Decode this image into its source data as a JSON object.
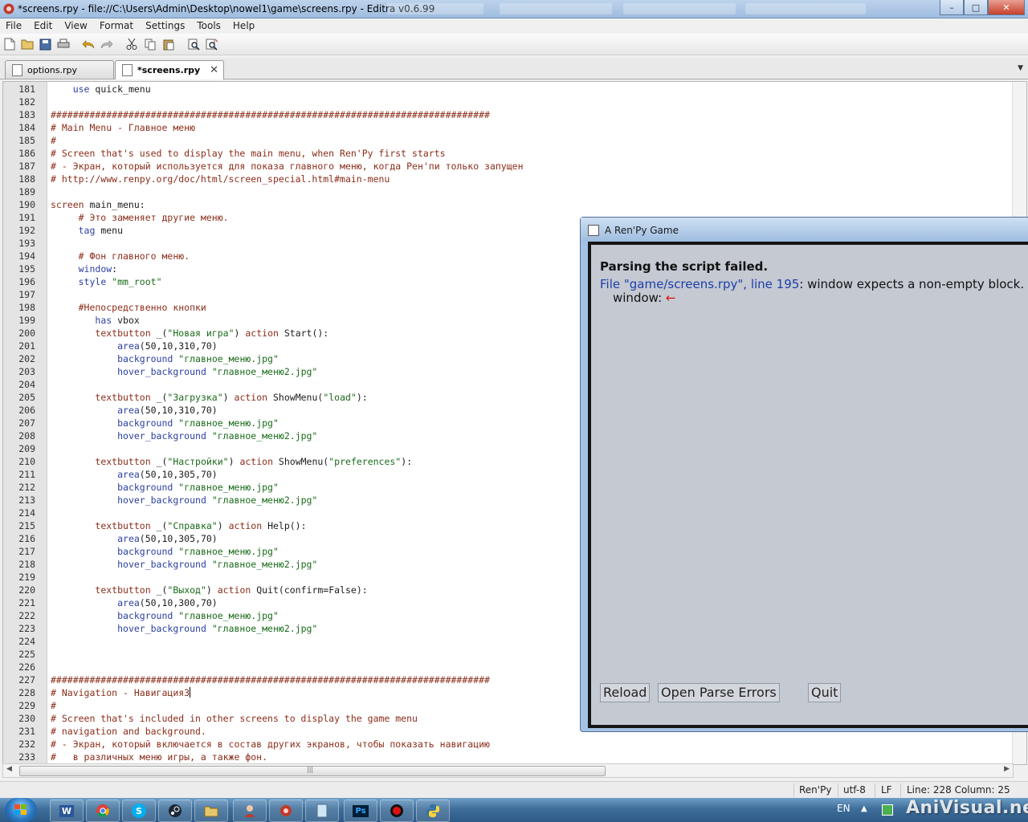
{
  "window": {
    "title": "*screens.rpy - file://C:\\Users\\Admin\\Desktop\\nowel1\\game\\screens.rpy - Editra v0.6.99",
    "min": "–",
    "max": "□",
    "close": "✕"
  },
  "menubar": [
    "File",
    "Edit",
    "View",
    "Format",
    "Settings",
    "Tools",
    "Help"
  ],
  "toolbar": [
    "new-file-icon",
    "open-folder-icon",
    "save-icon",
    "print-icon",
    "undo-icon",
    "redo-icon",
    "cut-icon",
    "copy-icon",
    "paste-icon",
    "find-icon",
    "find-replace-icon"
  ],
  "tabs": [
    {
      "label": "options.rpy",
      "active": false
    },
    {
      "label": "*screens.rpy",
      "active": true,
      "close": "✕"
    }
  ],
  "editor": {
    "lines": [
      {
        "n": "181",
        "t": "    use quick_menu"
      },
      {
        "n": "182",
        "t": ""
      },
      {
        "n": "183",
        "t": "###############################################################################"
      },
      {
        "n": "184",
        "t": "# Main Menu - Главное меню"
      },
      {
        "n": "185",
        "t": "#"
      },
      {
        "n": "186",
        "t": "# Screen that's used to display the main menu, when Ren'Py first starts"
      },
      {
        "n": "187",
        "t": "# - Экран, который используется для показа главного меню, когда Рен'пи только запущен"
      },
      {
        "n": "188",
        "t": "# http://www.renpy.org/doc/html/screen_special.html#main-menu"
      },
      {
        "n": "189",
        "t": ""
      },
      {
        "n": "190",
        "t": "screen main_menu:"
      },
      {
        "n": "191",
        "t": "     # Это заменяет другие меню."
      },
      {
        "n": "192",
        "t": "     tag menu"
      },
      {
        "n": "193",
        "t": ""
      },
      {
        "n": "194",
        "t": "     # Фон главного меню."
      },
      {
        "n": "195",
        "t": "     window:"
      },
      {
        "n": "196",
        "t": "     style \"mm_root\""
      },
      {
        "n": "197",
        "t": ""
      },
      {
        "n": "198",
        "t": "     #Непосредственно кнопки"
      },
      {
        "n": "199",
        "t": "        has vbox"
      },
      {
        "n": "200",
        "t": "        textbutton _(\"Новая игра\") action Start():"
      },
      {
        "n": "201",
        "t": "            area(50,10,310,70)"
      },
      {
        "n": "202",
        "t": "            background \"главное_меню.jpg\""
      },
      {
        "n": "203",
        "t": "            hover_background \"главное_меню2.jpg\""
      },
      {
        "n": "204",
        "t": ""
      },
      {
        "n": "205",
        "t": "        textbutton _(\"Загрузка\") action ShowMenu(\"load\"):"
      },
      {
        "n": "206",
        "t": "            area(50,10,310,70)"
      },
      {
        "n": "207",
        "t": "            background \"главное_меню.jpg\""
      },
      {
        "n": "208",
        "t": "            hover_background \"главное_меню2.jpg\""
      },
      {
        "n": "209",
        "t": ""
      },
      {
        "n": "210",
        "t": "        textbutton _(\"Настройки\") action ShowMenu(\"preferences\"):"
      },
      {
        "n": "211",
        "t": "            area(50,10,305,70)"
      },
      {
        "n": "212",
        "t": "            background \"главное_меню.jpg\""
      },
      {
        "n": "213",
        "t": "            hover_background \"главное_меню2.jpg\""
      },
      {
        "n": "214",
        "t": ""
      },
      {
        "n": "215",
        "t": "        textbutton _(\"Справка\") action Help():"
      },
      {
        "n": "216",
        "t": "            area(50,10,305,70)"
      },
      {
        "n": "217",
        "t": "            background \"главное_меню.jpg\""
      },
      {
        "n": "218",
        "t": "            hover_background \"главное_меню2.jpg\""
      },
      {
        "n": "219",
        "t": ""
      },
      {
        "n": "220",
        "t": "        textbutton _(\"Выход\") action Quit(confirm=False):"
      },
      {
        "n": "221",
        "t": "            area(50,10,300,70)"
      },
      {
        "n": "222",
        "t": "            background \"главное_меню.jpg\""
      },
      {
        "n": "223",
        "t": "            hover_background \"главное_меню2.jpg\""
      },
      {
        "n": "224",
        "t": ""
      },
      {
        "n": "225",
        "t": ""
      },
      {
        "n": "226",
        "t": ""
      },
      {
        "n": "227",
        "t": "###############################################################################"
      },
      {
        "n": "228",
        "t": "# Navigation - Навигация3"
      },
      {
        "n": "229",
        "t": "#"
      },
      {
        "n": "230",
        "t": "# Screen that's included in other screens to display the game menu"
      },
      {
        "n": "231",
        "t": "# navigation and background."
      },
      {
        "n": "232",
        "t": "# - Экран, который включается в состав других экранов, чтобы показать навигацию"
      },
      {
        "n": "233",
        "t": "#   в различных меню игры, а также фон."
      }
    ]
  },
  "statusbar": {
    "lexer": "Ren'Py",
    "encoding": "utf-8",
    "eol": "LF",
    "position": "Line: 228  Column: 25"
  },
  "renpy_dialog": {
    "title": "A Ren'Py Game",
    "heading": "Parsing the script failed.",
    "file_link": "File \"game/screens.rpy\", line 195",
    "message": ": window expects a non-empty block.",
    "context": "window: ",
    "arrow": "←",
    "buttons": {
      "reload": "Reload",
      "open_errors": "Open Parse Errors",
      "quit": "Quit"
    }
  },
  "taskbar": {
    "lang": "EN",
    "watermark": "AniVisual.net"
  }
}
